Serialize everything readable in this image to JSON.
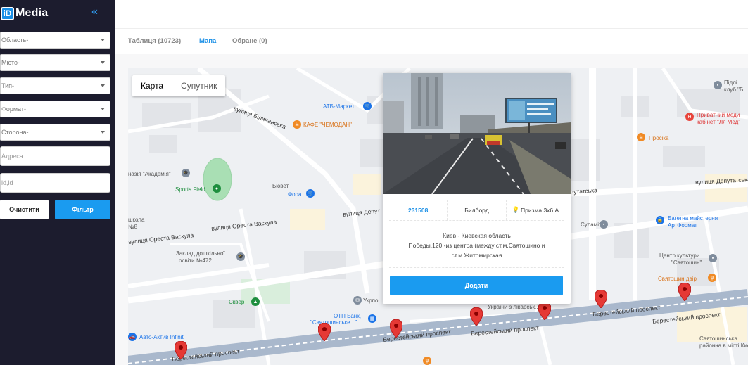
{
  "brand": {
    "badge": "iD",
    "name": "Media",
    "collapse_icon": "double-chevron-left-icon"
  },
  "filters": {
    "region": "Область-",
    "city": "Місто-",
    "type": "Тип-",
    "format": "Формат-",
    "side": "Сторона-",
    "address_placeholder": "Адресa",
    "id_placeholder": "id,id",
    "clear_label": "Очистити",
    "filter_label": "Фільтр"
  },
  "tabs": [
    {
      "label": "Таблиця (10723)",
      "active": false
    },
    {
      "label": "Мапа",
      "active": true
    },
    {
      "label": "Обране (0)",
      "active": false
    }
  ],
  "map": {
    "type_map": "Карта",
    "type_satellite": "Супутник",
    "streets": {
      "bilichanska": "вулиця Біличанська",
      "vaskula1": "вулиця Ореста Васкула",
      "vaskula2": "вулиця Ореста Васкула",
      "deputatska_left": "вулиця Депут",
      "deputatska_mid": "Депутатська",
      "deputatska_right": "вулиця Депутатська",
      "berestejskyi1": "Берестейський проспект",
      "berestejskyi2": "Берестейський проспект",
      "berestejskyi3": "Берестейський проспект",
      "berestejskyi4": "Берестейський проспект",
      "berestejskyi5": "Берестейський проспект"
    },
    "labels": {
      "atb": "АТБ-Маркет",
      "cafe": "КАФЕ \"ЧЕМОДАН\"",
      "gymn": "назія \"Академія\"",
      "sports": "Sports Field",
      "buvet": "Бювет",
      "fora": "Фора",
      "school1": "школа",
      "school2": "№8",
      "kinder1": "Заклад дошкільної",
      "kinder2": "освіти №472",
      "skver": "Сквер",
      "ukrposhta": "Укрпо",
      "otp1": "ОТП Банк,",
      "otp2": "\"Святошинське...\"",
      "auto": "Авто-Актив Infiniti",
      "ukraine": "України з лікарськ...",
      "club1": "Підлі",
      "club2": "клуб \"Б",
      "private1": "Приватний меди",
      "private2": "кабінет \"Ля Мед\"",
      "proskia": "Просікa",
      "bagetna1": "Багетна майстерня",
      "bagetna2": "АртФормат",
      "kultura1": "Центр культури",
      "kultura2": "\"Святошин\"",
      "dvir": "Святошин двір",
      "zulamita": "Суламіта\"",
      "rayonna1": "Святошинська",
      "rayonna2": "районна в місті Києві"
    }
  },
  "popup": {
    "id": "231508",
    "type": "Билборд",
    "format": "Призма 3х6 А",
    "address_line1": "Киев - Киевская область",
    "address_line2": "Победы,120 -из центра (между ст.м.Святошино и",
    "address_line3": "ст.м.Житомирская",
    "add_label": "Додати"
  }
}
